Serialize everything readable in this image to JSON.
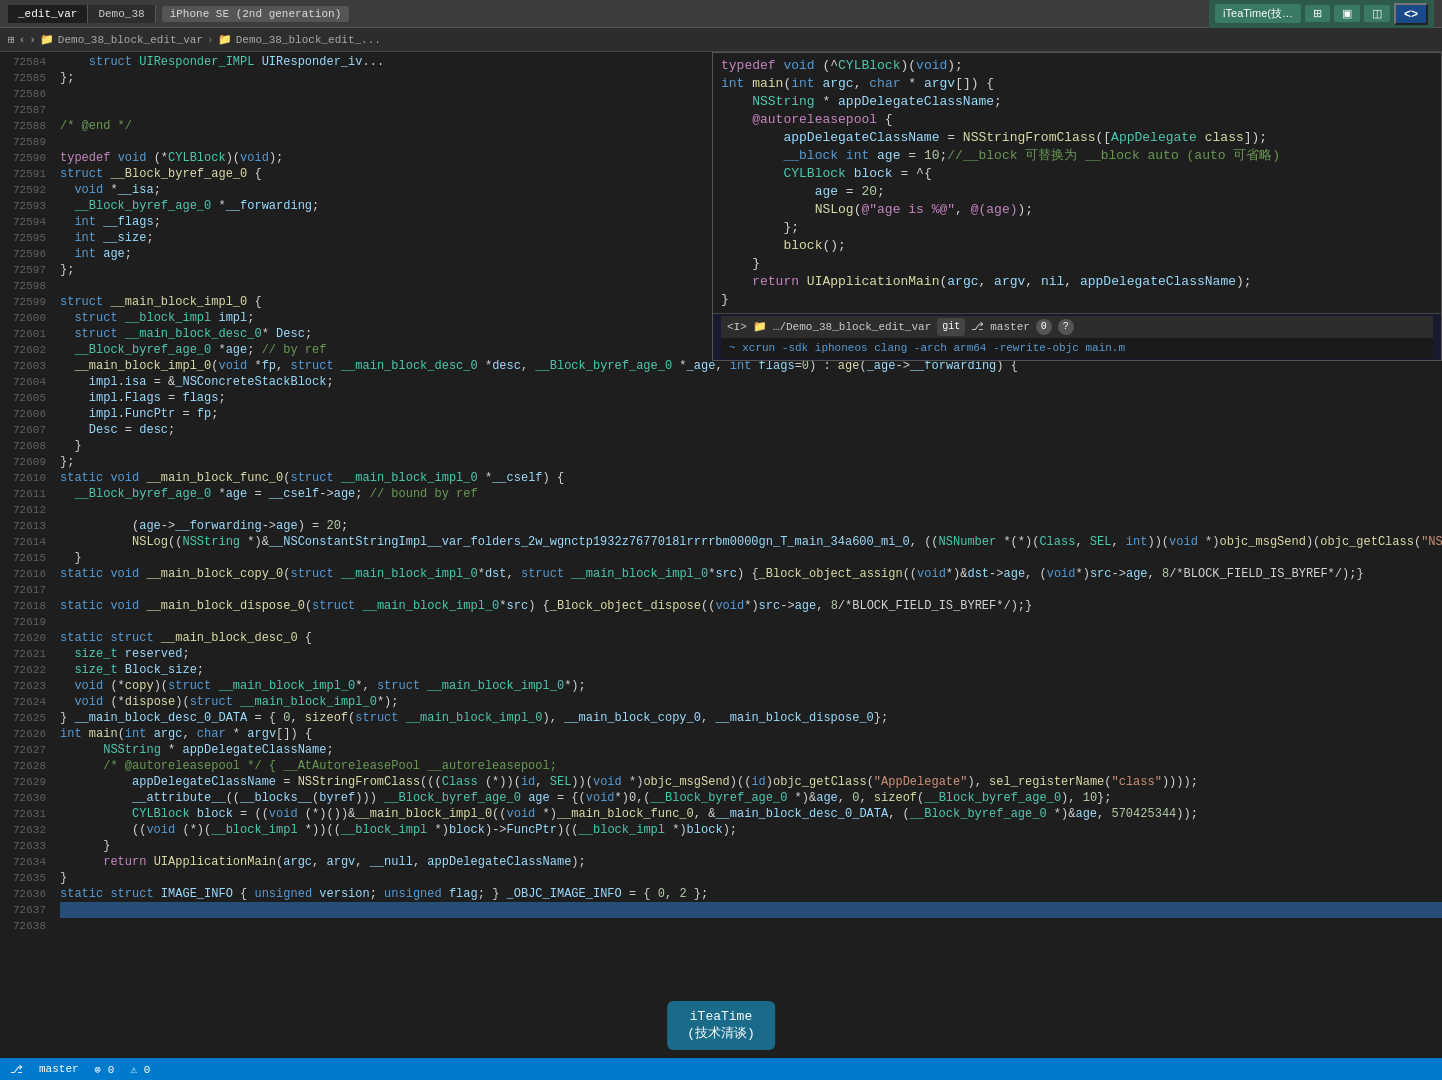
{
  "topbar": {
    "tab1": "_edit_var",
    "tab2": "Demo_38",
    "device": "iPhone SE (2nd generation)",
    "breadcrumb1": "Demo_38_block_edit_var",
    "breadcrumb2": "Demo_38_block_edit_..."
  },
  "statusbar": {
    "text": ""
  },
  "floatPanel": {
    "lines": [
      "typedef void (^CYLBlock)(void);",
      "int main(int argc, char * argv[]) {",
      "    NSString * appDelegateClassName;",
      "    @autoreleasepool {",
      "        appDelegateClassName = NSStringFromClass([AppDelegate class]);",
      "        __block int age = 10;//__block 可替换为 __block auto (auto 可省略)",
      "        CYLBlock block = ^{",
      "            age = 20;",
      "            NSLog(@\"age is %@\", @(age));",
      "        };",
      "        block();",
      "    }",
      "    return UIApplicationMain(argc, argv, nil, appDelegateClassName);",
      "}"
    ],
    "terminal": {
      "prompt": "<I>",
      "path": "…/Demo_38_block_edit_var",
      "branch": "git",
      "branchName": "master",
      "badge1": "0",
      "badge2": "?",
      "command": "~ xcrun -sdk iphoneos clang -arch arm64 -rewrite-objc main.m"
    }
  },
  "iteaTime": {
    "line1": "iTeaTime",
    "line2": "(技术清谈)"
  },
  "lineNumbers": [
    72584,
    72585,
    72586,
    72587,
    72588,
    72589,
    72590,
    72591,
    72592,
    72593,
    72594,
    72595,
    72596,
    72597,
    72598,
    72599,
    72600,
    72601,
    72602,
    72603,
    72604,
    72605,
    72606,
    72607,
    72608,
    72609,
    72610,
    72611,
    72612,
    72613,
    72614,
    72615,
    72616,
    72617,
    72618,
    72619,
    72620,
    72621,
    72622,
    72623,
    72624,
    72625,
    72626,
    72627,
    72628,
    72629,
    72630,
    72631,
    72632,
    72633,
    72634,
    72635,
    72636,
    72637,
    72638
  ]
}
